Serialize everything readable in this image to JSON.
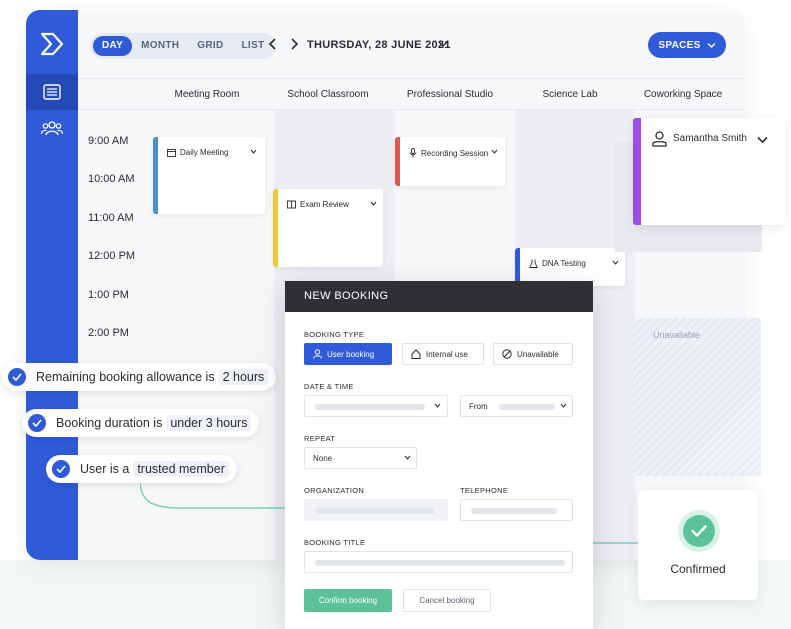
{
  "view_tabs": [
    {
      "label": "DAY",
      "active": true
    },
    {
      "label": "MONTH",
      "active": false
    },
    {
      "label": "GRID",
      "active": false
    },
    {
      "label": "LIST",
      "active": false
    }
  ],
  "date_label": "THURSDAY, 28 JUNE 2021",
  "spaces_label": "SPACES",
  "columns": [
    "Meeting Room",
    "School Classroom",
    "Professional Studio",
    "Science Lab",
    "Coworking Space"
  ],
  "times": [
    "9:00 AM",
    "10:00 AM",
    "11:00 AM",
    "12:00 PM",
    "1:00 PM",
    "2:00 PM"
  ],
  "events": {
    "daily_meeting": {
      "title": "Daily Meeting",
      "color": "#4a90c8"
    },
    "exam_review": {
      "title": "Exam Review",
      "color": "#f0c63a"
    },
    "recording_session": {
      "title": "Recording Session",
      "color": "#e4544f"
    },
    "dna_testing": {
      "title": "DNA Testing",
      "color": "#2f5bd8"
    },
    "samantha": {
      "title": "Samantha Smith",
      "color": "#9b4de6"
    }
  },
  "unavailable_label": "Unavailable",
  "modal": {
    "title": "NEW BOOKING",
    "booking_type_label": "BOOKING TYPE",
    "types": [
      "User booking",
      "Internal use",
      "Unavailable"
    ],
    "date_time_label": "DATE & TIME",
    "from_label": "From",
    "repeat_label": "REPEAT",
    "repeat_value": "None",
    "organization_label": "ORGANIZATION",
    "telephone_label": "TELEPHONE",
    "booking_title_label": "BOOKING TITLE",
    "confirm_label": "Confirm booking",
    "cancel_label": "Cancel booking"
  },
  "rules": [
    {
      "text": "Remaining booking allowance is",
      "highlight": "2 hours"
    },
    {
      "text": "Booking duration is",
      "highlight": "under 3 hours"
    },
    {
      "text": "User is a",
      "highlight": "trusted member"
    }
  ],
  "confirmed_label": "Confirmed",
  "colors": {
    "primary": "#2f5bd8",
    "success": "#5cc29a",
    "dark": "#2f2f34"
  }
}
